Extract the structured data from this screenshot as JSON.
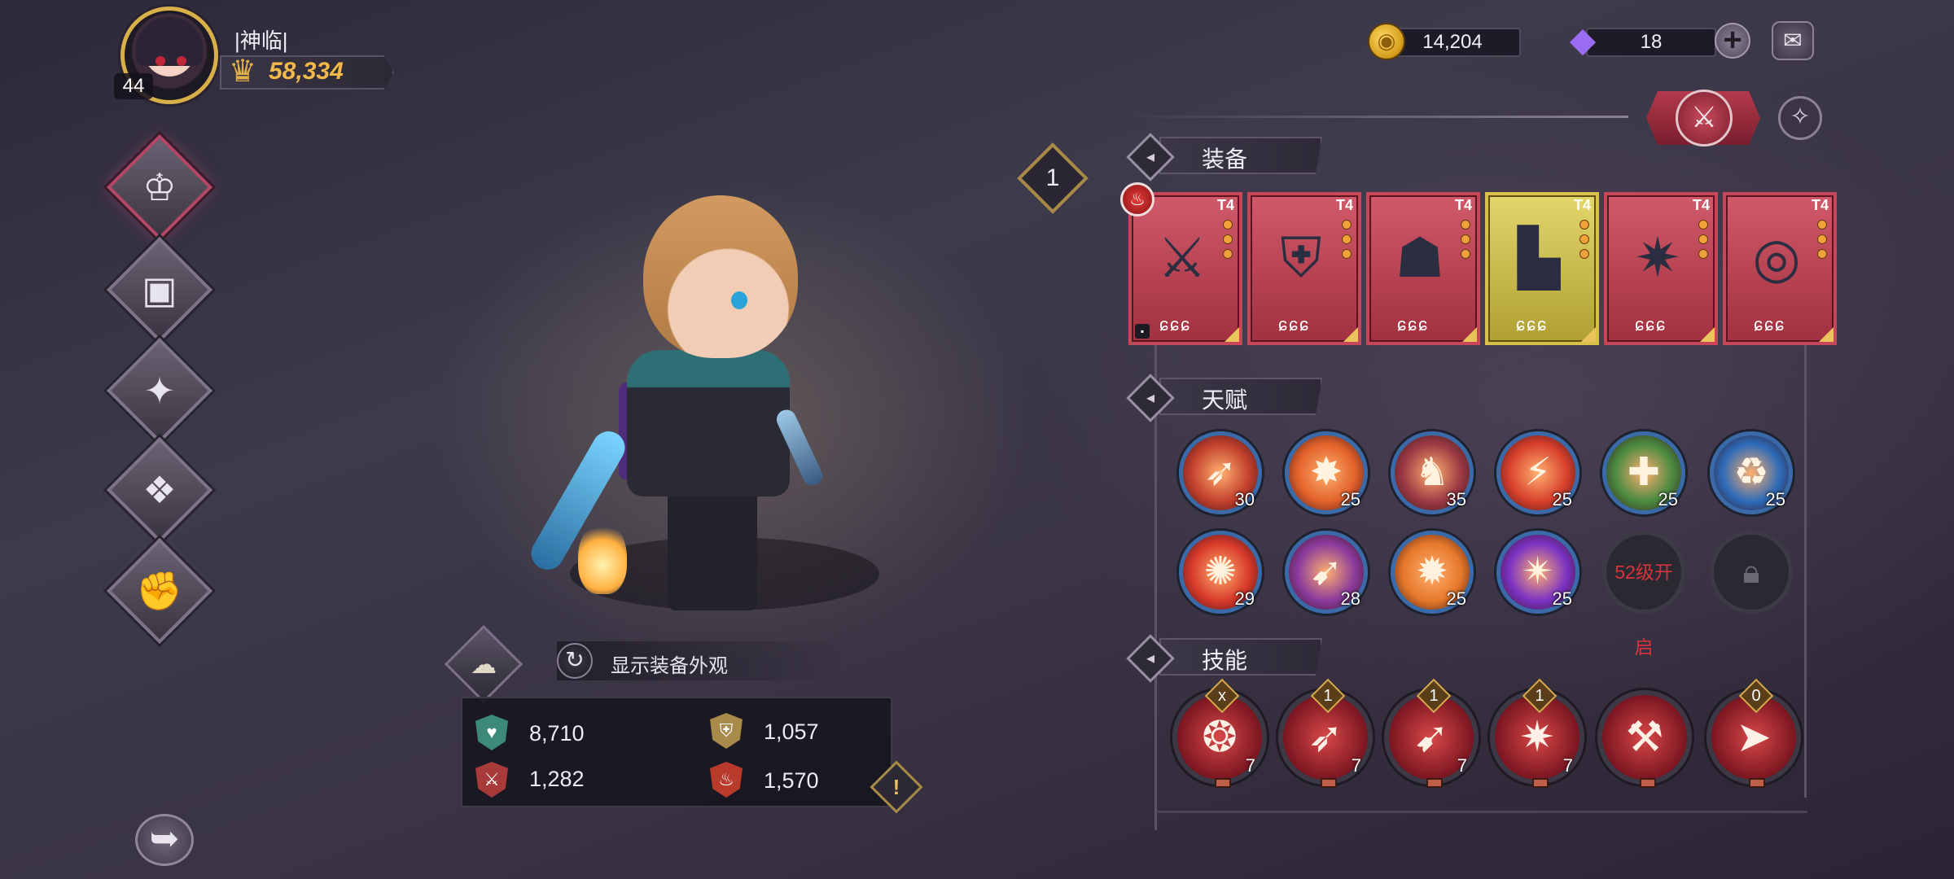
{
  "player": {
    "name": "|神临|",
    "level": "44",
    "power": "58,334"
  },
  "currency": {
    "gold": "14,204",
    "gems": "18"
  },
  "left_nav": [
    {
      "name": "nav-equipment",
      "icon": "helmet-icon",
      "glyph": "♔",
      "active": true
    },
    {
      "name": "nav-backpack",
      "icon": "backpack-icon",
      "glyph": "▣",
      "active": false
    },
    {
      "name": "nav-enchant",
      "icon": "enchant-sword-icon",
      "glyph": "✦",
      "active": false
    },
    {
      "name": "nav-spellbook",
      "icon": "spellbook-icon",
      "glyph": "❖",
      "active": false
    },
    {
      "name": "nav-upgrade",
      "icon": "fist-upgrade-icon",
      "glyph": "✊",
      "active": false
    }
  ],
  "appearance": {
    "label": "显示装备外观"
  },
  "stats": {
    "hp": "8,710",
    "defense": "1,057",
    "attack": "1,282",
    "fire": "1,570"
  },
  "equipment": {
    "title": "装备",
    "slot_level": "1",
    "cards": [
      {
        "tier": "T4",
        "icon": "sword-icon",
        "glyph": "⚔",
        "stars": "ɕɕɕ",
        "gold": false
      },
      {
        "tier": "T4",
        "icon": "armor-icon",
        "glyph": "⛨",
        "stars": "ɕɕɕ",
        "gold": false
      },
      {
        "tier": "T4",
        "icon": "hood-icon",
        "glyph": "☗",
        "stars": "ɕɕɕ",
        "gold": false
      },
      {
        "tier": "T4",
        "icon": "boots-icon",
        "glyph": "▙",
        "stars": "ɕɕɕ",
        "gold": true
      },
      {
        "tier": "T4",
        "icon": "amulet-icon",
        "glyph": "✷",
        "stars": "ɕɕɕ",
        "gold": false
      },
      {
        "tier": "T4",
        "icon": "ring-icon",
        "glyph": "◎",
        "stars": "ɕɕɕ",
        "gold": false
      }
    ]
  },
  "talents": {
    "title": "天赋",
    "items": [
      {
        "icon": "arrows-icon",
        "glyph": "➶",
        "level": "30",
        "color": "#c2402c",
        "ring": "#3a6aa8"
      },
      {
        "icon": "flame-warrior-icon",
        "glyph": "✸",
        "level": "25",
        "color": "#e2622a",
        "ring": "#3a6aa8"
      },
      {
        "icon": "shield-knight-icon",
        "glyph": "♞",
        "level": "35",
        "color": "#9c3a44",
        "ring": "#3a6aa8"
      },
      {
        "icon": "fire-blade-icon",
        "glyph": "⚡",
        "level": "25",
        "color": "#d8402c",
        "ring": "#3a6aa8"
      },
      {
        "icon": "heal-icon",
        "glyph": "✚",
        "level": "25",
        "color": "#4a8a40",
        "ring": "#3a6aa8"
      },
      {
        "icon": "recycle-icon",
        "glyph": "♻",
        "level": "25",
        "color": "#2c6ab8",
        "ring": "#3a6aa8"
      },
      {
        "icon": "fire-burst-icon",
        "glyph": "✺",
        "level": "29",
        "color": "#d83a2a",
        "ring": "#3a6aa8"
      },
      {
        "icon": "purple-slash-icon",
        "glyph": "➹",
        "level": "28",
        "color": "#8a3a9c",
        "ring": "#3a6aa8"
      },
      {
        "icon": "explosion-icon",
        "glyph": "✹",
        "level": "25",
        "color": "#e6782a",
        "ring": "#3a6aa8"
      },
      {
        "icon": "arcane-burst-icon",
        "glyph": "✴",
        "level": "25",
        "color": "#7a32c4",
        "ring": "#3a6aa8"
      }
    ],
    "locked_label": "52级开启"
  },
  "skills": {
    "title": "技能",
    "items": [
      {
        "icon": "swirl-strike-icon",
        "glyph": "❂",
        "badge": "x",
        "level": "7"
      },
      {
        "icon": "flame-slash-icon",
        "glyph": "➶",
        "badge": "1",
        "level": "7"
      },
      {
        "icon": "fire-wave-icon",
        "glyph": "➹",
        "badge": "1",
        "level": "7"
      },
      {
        "icon": "blade-storm-icon",
        "glyph": "✷",
        "badge": "1",
        "level": "7"
      },
      {
        "icon": "axe-strike-icon",
        "glyph": "⚒",
        "badge": "",
        "level": ""
      },
      {
        "icon": "boot-dash-icon",
        "glyph": "➤",
        "badge": "0",
        "level": ""
      }
    ]
  }
}
